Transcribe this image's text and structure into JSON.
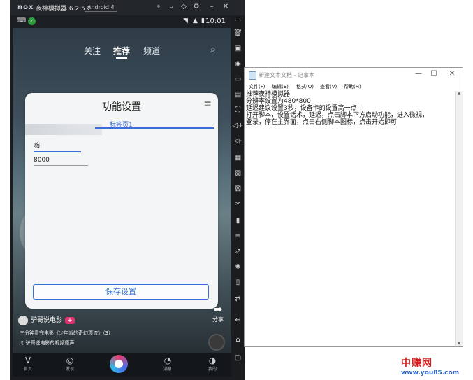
{
  "emulator": {
    "logo": "nox",
    "name": "夜神模拟器 6.2.5.2",
    "android": "Android 4",
    "status_time": "10:01",
    "controls": [
      "pin-icon",
      "chevron-down-icon",
      "keyboard-icon",
      "gear-icon",
      "minimize-icon",
      "close-icon"
    ],
    "sidebar_icons": [
      "more-icon",
      "trash-icon",
      "keymap-icon",
      "location-icon",
      "screen-icon",
      "apk-icon",
      "cut-icon",
      "volume-up-icon",
      "volume-down-icon",
      "screenshot-icon",
      "macro-icon",
      "multi-icon",
      "scissors-icon",
      "screen-record-icon",
      "menu-icon",
      "shake-icon",
      "loading-icon",
      "phone-icon",
      "sync-icon",
      "back-icon",
      "home-icon",
      "recent-icon"
    ]
  },
  "app": {
    "tabs": [
      "关注",
      "推荐",
      "频道"
    ],
    "active_tab": "推荐",
    "author": "驴哥说电影",
    "follow": "+",
    "description": "三分钟看完电影《少年派的奇幻漂流》（3）",
    "music": "♫ 驴哥说电影的视频原声",
    "share_label": "分享",
    "bottom_nav": [
      "首页",
      "发现",
      "",
      "消息",
      "我的"
    ]
  },
  "dialog": {
    "title": "功能设置",
    "tab": "标签页1",
    "field1_value": "嗨",
    "field2_value": "8000",
    "save_button": "保存设置"
  },
  "notepad": {
    "title": "新建文本文档 - 记事本",
    "menu": [
      "文件(F)",
      "编辑(E)",
      "格式(O)",
      "查看(V)",
      "帮助(H)"
    ],
    "lines": [
      "推荐夜神模拟器",
      "分辨率设置为480*800",
      "延迟建议设置3秒，设备卡的设置高一点!",
      "打开脚本，设置话术，延迟，点击脚本下方启动功能，进入微视，",
      "登录，停在主界面，点击右侧脚本图标，点击开始即可"
    ]
  },
  "watermark": {
    "cn": "中赚网",
    "url": "www.you85.com"
  }
}
